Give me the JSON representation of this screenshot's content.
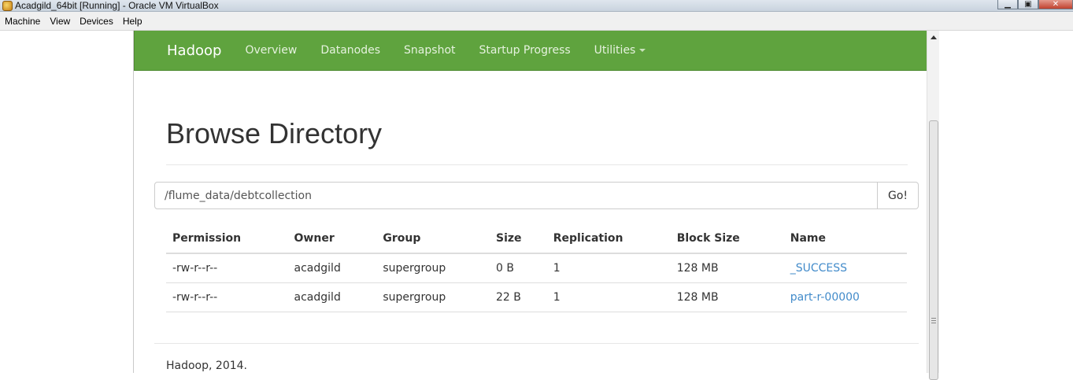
{
  "window": {
    "title": "Acadgild_64bit [Running] - Oracle VM VirtualBox",
    "buttons": {
      "minimize": "▁",
      "maximize": "▣",
      "close": "✕"
    }
  },
  "menubar": {
    "items": [
      "Machine",
      "View",
      "Devices",
      "Help"
    ]
  },
  "navbar": {
    "brand": "Hadoop",
    "links": [
      "Overview",
      "Datanodes",
      "Snapshot",
      "Startup Progress",
      "Utilities"
    ]
  },
  "page": {
    "title": "Browse Directory",
    "path_value": "/flume_data/debtcollection",
    "go_label": "Go!"
  },
  "table": {
    "headers": [
      "Permission",
      "Owner",
      "Group",
      "Size",
      "Replication",
      "Block Size",
      "Name"
    ],
    "rows": [
      [
        "-rw-r--r--",
        "acadgild",
        "supergroup",
        "0 B",
        "1",
        "128 MB",
        "_SUCCESS"
      ],
      [
        "-rw-r--r--",
        "acadgild",
        "supergroup",
        "22 B",
        "1",
        "128 MB",
        "part-r-00000"
      ]
    ]
  },
  "footer": {
    "text": "Hadoop, 2014."
  },
  "colors": {
    "navbar": "#5fa33e",
    "link": "#428bca"
  }
}
